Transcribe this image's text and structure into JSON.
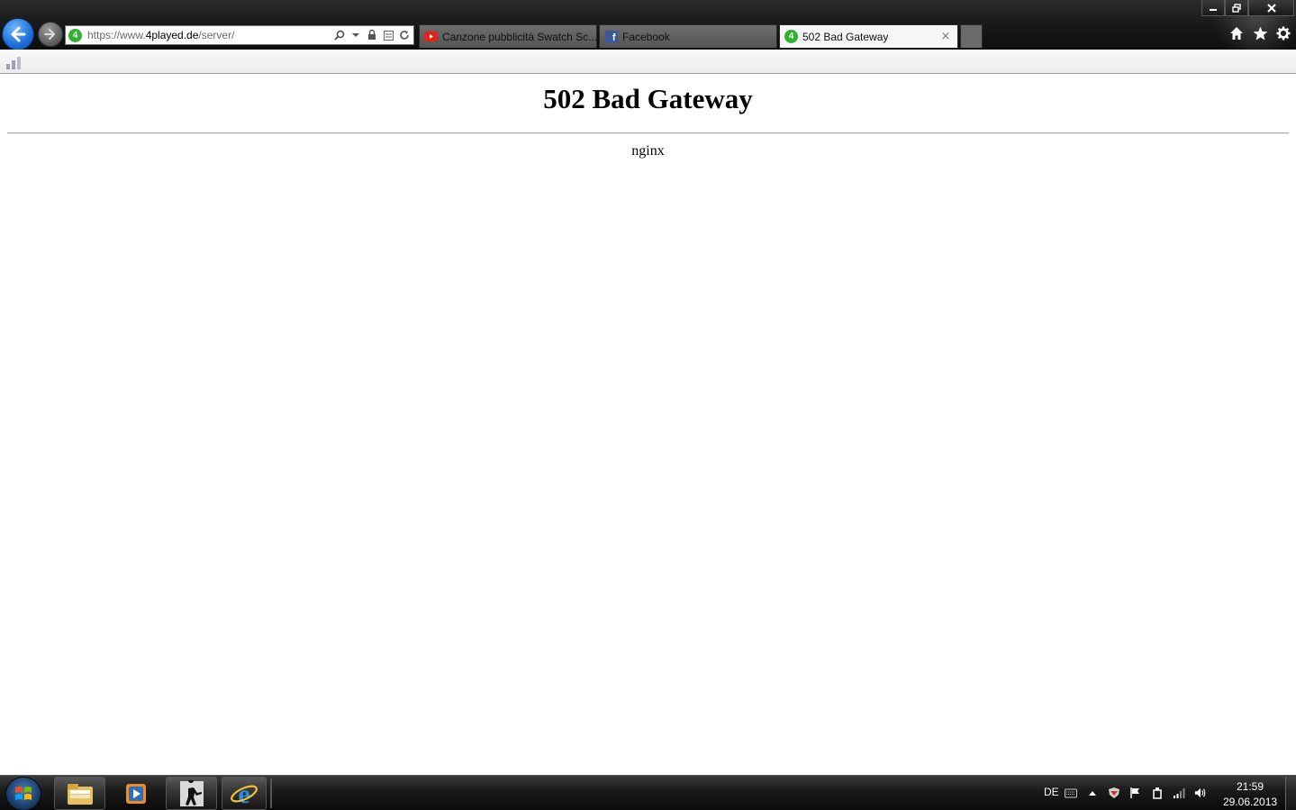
{
  "browser": {
    "address": {
      "scheme": "https://www.",
      "domain": "4played.de",
      "path": "/server/",
      "favicon_letter": "4"
    },
    "tabs": [
      {
        "title": "Canzone pubblicità Swatch Sc...",
        "icon": "youtube-icon",
        "active": false
      },
      {
        "title": "Facebook",
        "icon": "facebook-icon",
        "active": false
      },
      {
        "title": "502 Bad Gateway",
        "icon": "4played-icon",
        "active": true
      }
    ],
    "tab_close_glyph": "×",
    "favicon_letter_facebook": "f",
    "tool_icons": [
      "home-icon",
      "favorites-star-icon",
      "settings-gear-icon"
    ]
  },
  "page": {
    "title": "502 Bad Gateway",
    "server": "nginx"
  },
  "taskbar": {
    "pinned": [
      "explorer-icon",
      "media-player-icon",
      "counter-strike-icon",
      "internet-explorer-icon"
    ],
    "tray": {
      "language": "DE",
      "time": "21:59",
      "date": "29.06.2013"
    }
  },
  "colors": {
    "accent_blue": "#1e6fd9",
    "site_green": "#2fb32f",
    "youtube_red": "#e62117",
    "facebook_blue": "#3b5998"
  }
}
